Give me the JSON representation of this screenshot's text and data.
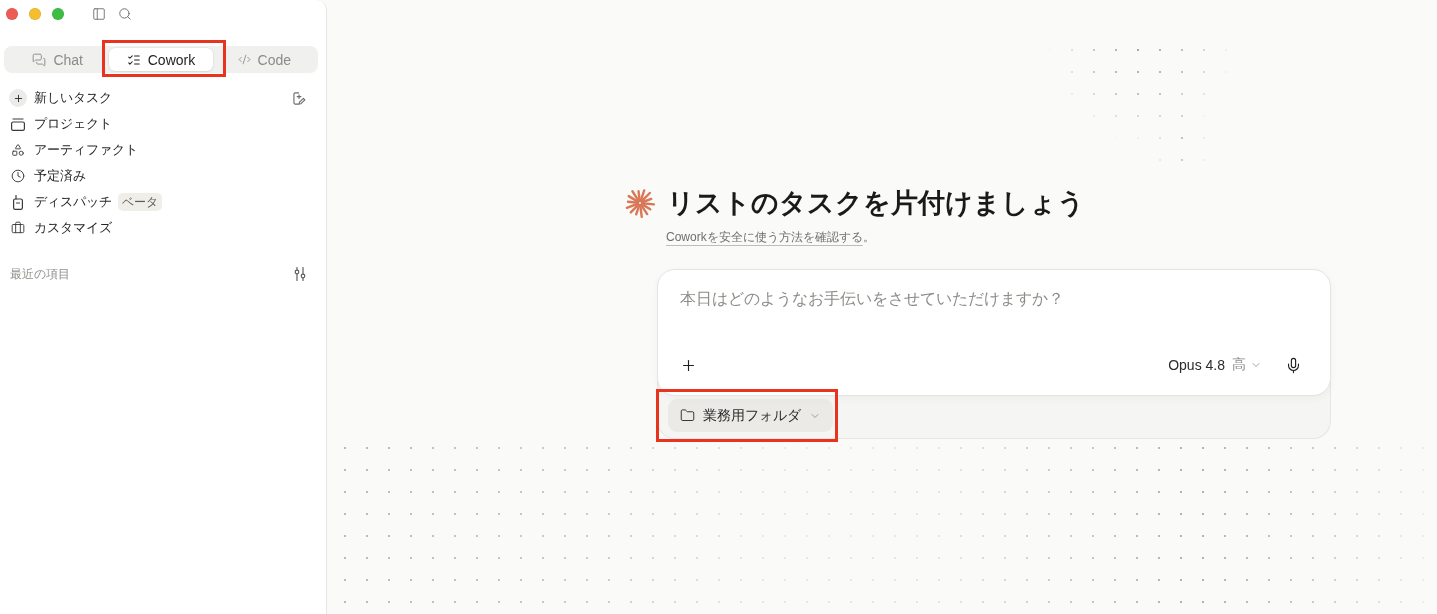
{
  "sidebar": {
    "tabs": [
      {
        "label": "Chat",
        "selected": false,
        "highlighted": false
      },
      {
        "label": "Cowork",
        "selected": true,
        "highlighted": true
      },
      {
        "label": "Code",
        "selected": false,
        "highlighted": false
      }
    ],
    "items": [
      {
        "kind": "action",
        "label": "新しいタスク"
      },
      {
        "kind": "link",
        "label": "プロジェクト"
      },
      {
        "kind": "link",
        "label": "アーティファクト"
      },
      {
        "kind": "link",
        "label": "予定済み"
      },
      {
        "kind": "link",
        "label": "ディスパッチ",
        "badge": "ベータ"
      },
      {
        "kind": "link",
        "label": "カスタマイズ"
      }
    ],
    "recent": {
      "heading": "最近の項目"
    }
  },
  "main": {
    "heading": "リストのタスクを片付けましょう",
    "help_text": {
      "link": "Coworkを安全に使う方法を確認する",
      "after": "。"
    },
    "composer": {
      "placeholder": "本日はどのようなお手伝いをさせていただけますか？",
      "model": "Opus 4.8",
      "effort": "高"
    },
    "folder": {
      "label": "業務用フォルダ",
      "highlighted": true
    }
  }
}
